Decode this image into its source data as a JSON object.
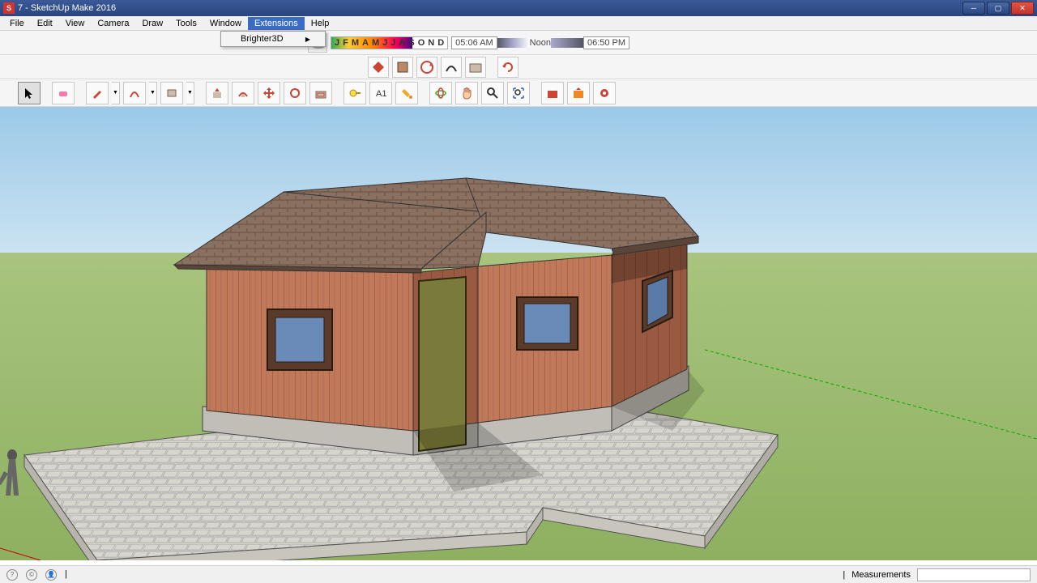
{
  "titlebar": {
    "doc": "7",
    "app": "SketchUp Make 2016"
  },
  "menubar": {
    "items": [
      "File",
      "Edit",
      "View",
      "Camera",
      "Draw",
      "Tools",
      "Window",
      "Extensions",
      "Help"
    ],
    "active_index": 7
  },
  "dropdown": {
    "item0": "Brighter3D"
  },
  "shadow": {
    "months": [
      "J",
      "F",
      "M",
      "A",
      "M",
      "J",
      "J",
      "A",
      "S",
      "O",
      "N",
      "D"
    ],
    "time_start": "05:06 AM",
    "noon": "Noon",
    "time_end": "06:50 PM"
  },
  "mid_tools": {
    "names": [
      "move-all",
      "paint-bucket-lg",
      "rotate-lg",
      "followme-lg",
      "scale-lg",
      "orbit-lg"
    ]
  },
  "main_tools": {
    "names": [
      "select",
      "eraser",
      "pencil",
      "arc",
      "rectangle",
      "pushpull",
      "followme",
      "move",
      "rotate",
      "offset",
      "tape",
      "text",
      "paint",
      "orbit",
      "pan",
      "zoom",
      "zoom-extents",
      "model-info",
      "3dwh",
      "share",
      "warehouse"
    ]
  },
  "statusbar": {
    "measurements_label": "Measurements"
  }
}
